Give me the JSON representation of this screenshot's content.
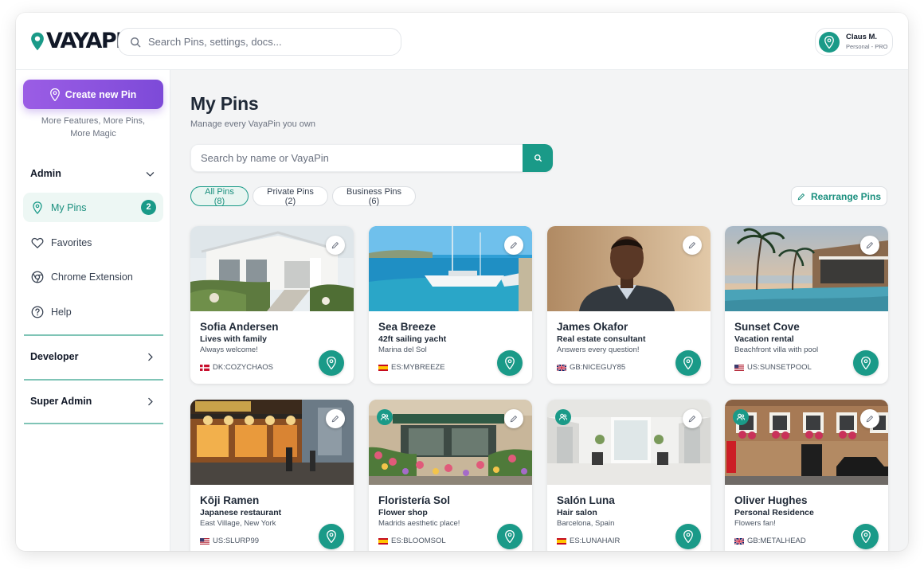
{
  "app": {
    "logo_text": "VAYAPIN"
  },
  "header": {
    "search_placeholder": "Search Pins, settings, docs...",
    "user": {
      "name": "Claus M.",
      "plan": "Personal - PRO"
    }
  },
  "sidebar": {
    "create_label": "Create new Pin",
    "create_sub_line1": "More Features, More Pins,",
    "create_sub_line2": "More Magic",
    "admin_label": "Admin",
    "items": [
      {
        "label": "My Pins",
        "badge": "2",
        "icon": "pin-icon"
      },
      {
        "label": "Favorites",
        "icon": "heart-icon"
      },
      {
        "label": "Chrome Extension",
        "icon": "chrome-icon"
      },
      {
        "label": "Help",
        "icon": "help-icon"
      }
    ],
    "developer_label": "Developer",
    "super_admin_label": "Super Admin"
  },
  "main": {
    "title": "My Pins",
    "subtitle": "Manage every VayaPin you own",
    "search_placeholder": "Search by name or VayaPin",
    "filters": [
      {
        "label": "All Pins (8)",
        "active": true
      },
      {
        "label": "Private Pins (2)",
        "active": false
      },
      {
        "label": "Business Pins (6)",
        "active": false
      }
    ],
    "rearrange_label": "Rearrange Pins"
  },
  "pins": [
    {
      "name": "Sofia Andersen",
      "tagline": "Lives with family",
      "description": "Always welcome!",
      "id": "DK:COZYCHAOS",
      "flag": "DK",
      "business": false,
      "scene": "house-photo"
    },
    {
      "name": "Sea Breeze",
      "tagline": "42ft sailing yacht",
      "description": "Marina del Sol",
      "id": "ES:MYBREEZE",
      "flag": "ES",
      "business": false,
      "scene": "yacht-photo"
    },
    {
      "name": "James Okafor",
      "tagline": "Real estate consultant",
      "description": "Answers every question!",
      "id": "GB:NICEGUY85",
      "flag": "GB",
      "business": false,
      "scene": "portrait-photo"
    },
    {
      "name": "Sunset Cove",
      "tagline": "Vacation rental",
      "description": "Beachfront villa with pool",
      "id": "US:SUNSETPOOL",
      "flag": "US",
      "business": false,
      "scene": "villa-photo"
    },
    {
      "name": "Kōji Ramen",
      "tagline": "Japanese restaurant",
      "description": "East Village, New York",
      "id": "US:SLURP99",
      "flag": "US",
      "business": false,
      "scene": "ramen-photo"
    },
    {
      "name": "Floristería Sol",
      "tagline": "Flower shop",
      "description": "Madrids aesthetic place!",
      "id": "ES:BLOOMSOL",
      "flag": "ES",
      "business": true,
      "scene": "flower-shop-photo"
    },
    {
      "name": "Salón Luna",
      "tagline": "Hair salon",
      "description": "Barcelona, Spain",
      "id": "ES:LUNAHAIR",
      "flag": "ES",
      "business": true,
      "scene": "salon-photo"
    },
    {
      "name": "Oliver Hughes",
      "tagline": "Personal Residence",
      "description": "Flowers fan!",
      "id": "GB:METALHEAD",
      "flag": "GB",
      "business": true,
      "scene": "townhouse-photo"
    }
  ],
  "colors": {
    "accent": "#1a9a88",
    "purple": "#8b55e0",
    "active_bg": "#edf7f4"
  }
}
